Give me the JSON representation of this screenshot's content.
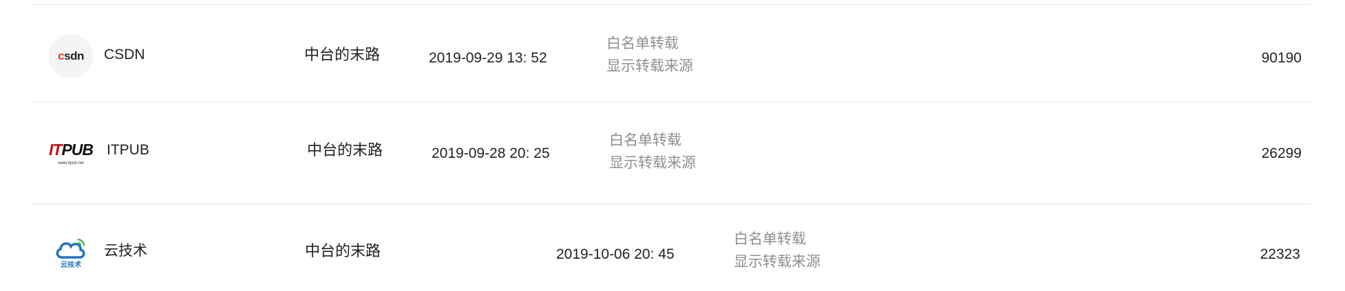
{
  "rows": [
    {
      "logo_icon": "csdn-logo-icon",
      "logo_text": "CSDN",
      "site": "CSDN",
      "author": "中台的末路",
      "date": "2019-09-29 13: 52",
      "permissions": [
        "白名单转载",
        "显示转载来源"
      ],
      "views": "90190",
      "accent": "#e33e1b"
    },
    {
      "logo_icon": "itpub-logo-icon",
      "logo_text": "ITPUB",
      "logo_subtext": "www.itpub.net",
      "site": "ITPUB",
      "author": "中台的末路",
      "date": "2019-09-28 20: 25",
      "permissions": [
        "白名单转载",
        "显示转载来源"
      ],
      "views": "26299",
      "accent": "#c40f0f"
    },
    {
      "logo_icon": "cloud-tech-logo-icon",
      "logo_text": "云技术",
      "site": "云技术",
      "author": "中台的末路",
      "date": "2019-10-06 20: 45",
      "permissions": [
        "白名单转载",
        "显示转载来源"
      ],
      "views": "22323",
      "accent": "#1a73c7",
      "accent2": "#4caf50"
    }
  ]
}
